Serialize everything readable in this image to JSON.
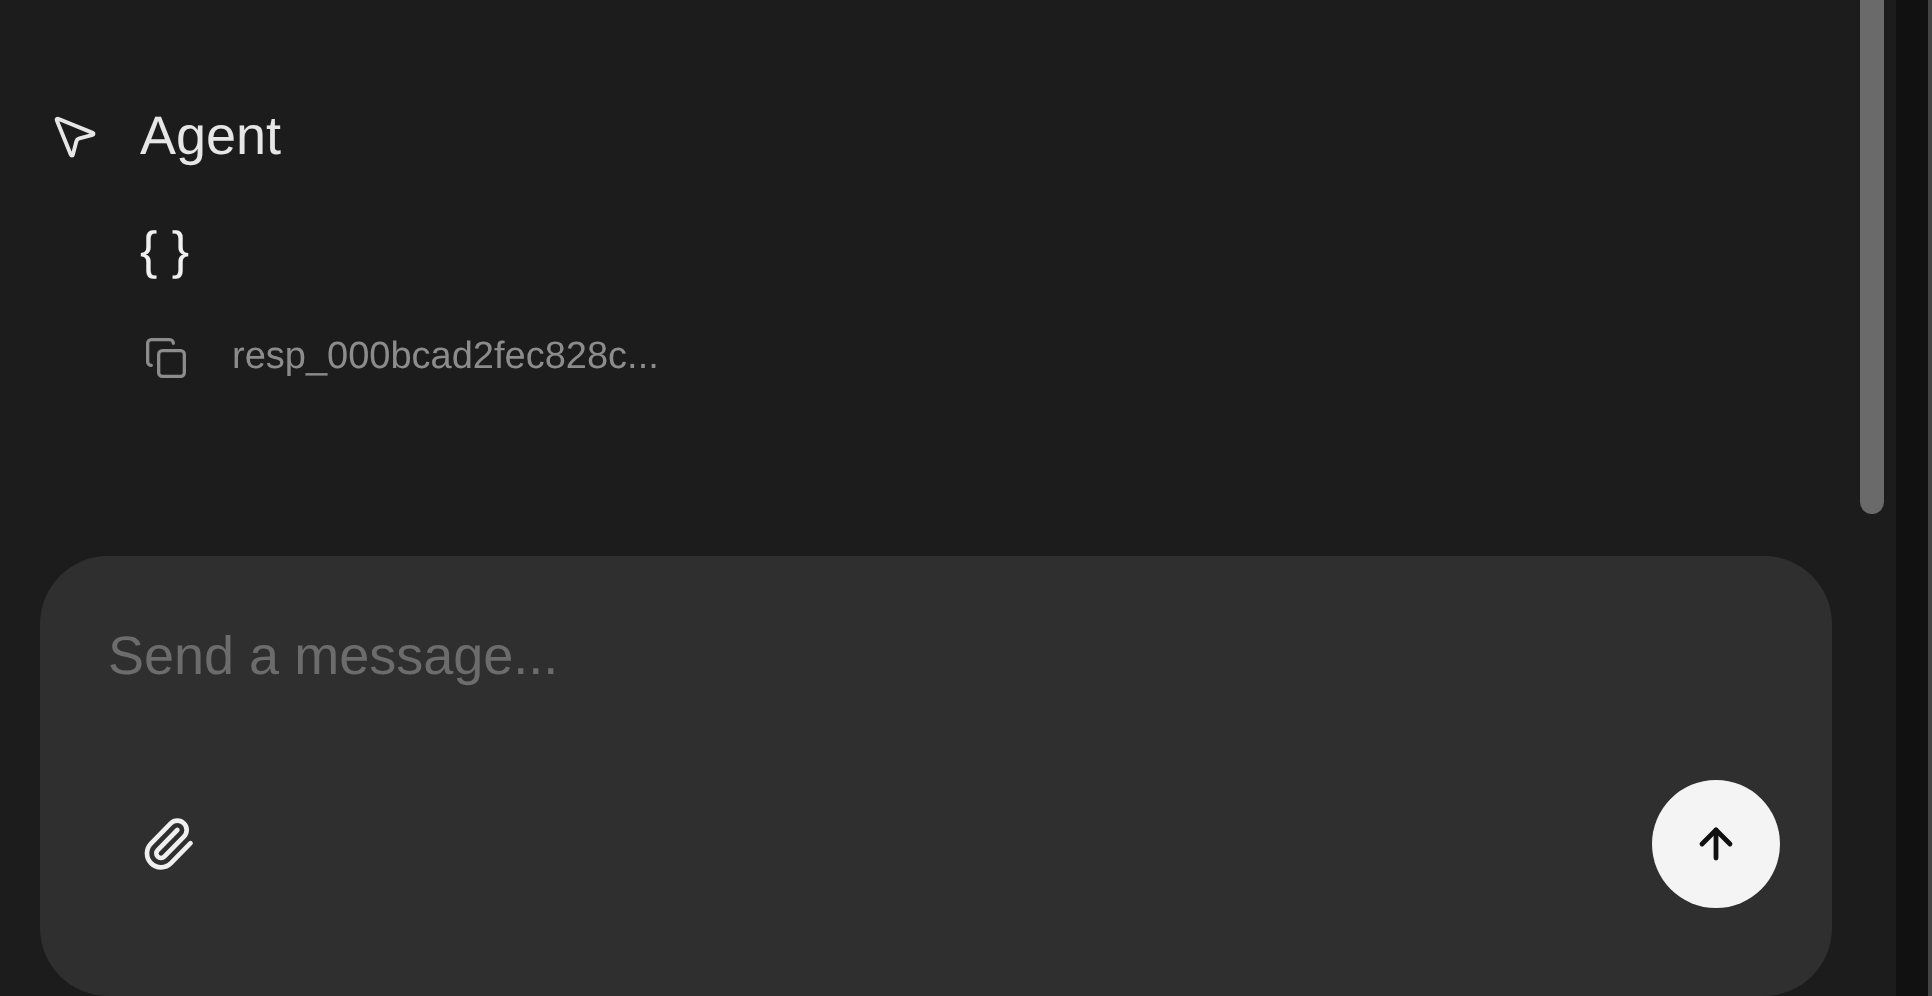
{
  "messages": [
    {
      "author": "Agent",
      "content": "{ }",
      "response_id": "resp_000bcad2fec828c..."
    }
  ],
  "composer": {
    "placeholder": "Send a message..."
  }
}
